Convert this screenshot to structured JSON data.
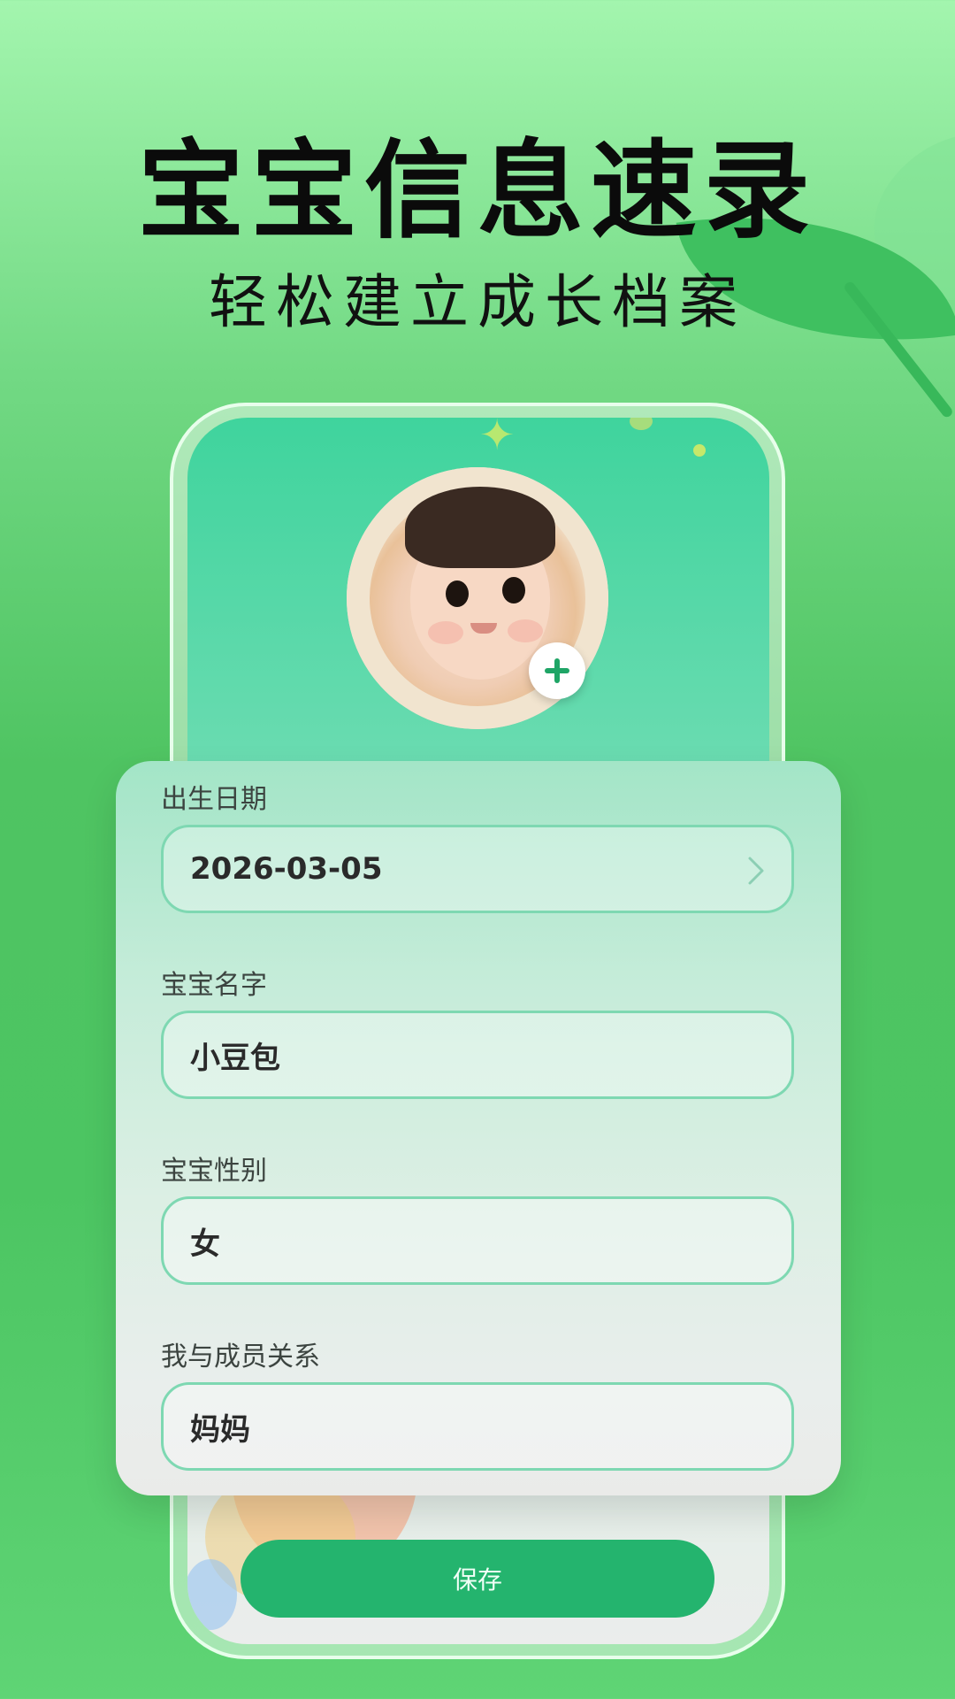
{
  "header": {
    "title": "宝宝信息速录",
    "subtitle": "轻松建立成长档案"
  },
  "avatar": {
    "add_icon": "plus-icon"
  },
  "form": {
    "fields": [
      {
        "label": "出生日期",
        "value": "2026-03-05",
        "icon": "chevron-right-icon"
      },
      {
        "label": "宝宝名字",
        "value": "小豆包"
      },
      {
        "label": "宝宝性别",
        "value": "女"
      },
      {
        "label": "我与成员关系",
        "value": "妈妈"
      }
    ]
  },
  "actions": {
    "save_label": "保存"
  },
  "colors": {
    "accent": "#24b46e",
    "field_border": "#7ed8b2",
    "background_top": "#a3f5ae",
    "background_mid": "#4fc462"
  }
}
